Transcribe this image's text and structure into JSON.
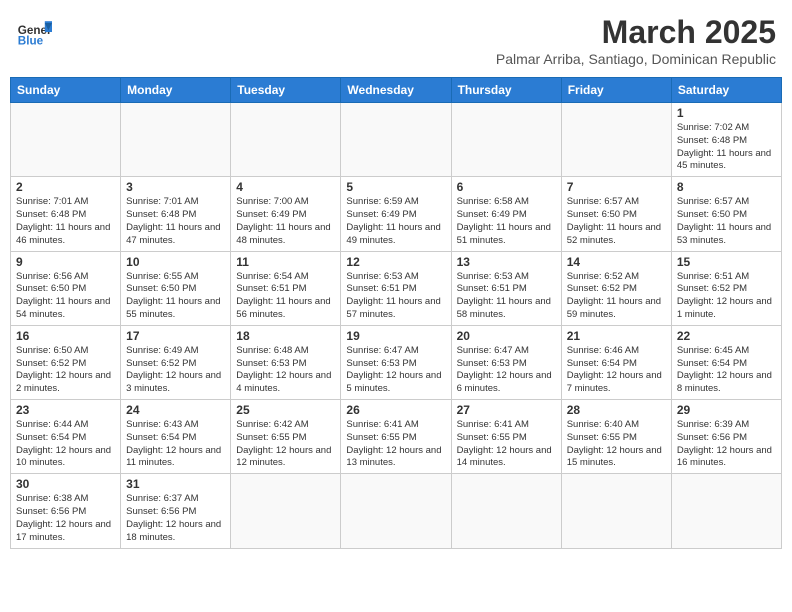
{
  "header": {
    "logo_general": "General",
    "logo_blue": "Blue",
    "month_year": "March 2025",
    "location": "Palmar Arriba, Santiago, Dominican Republic"
  },
  "weekdays": [
    "Sunday",
    "Monday",
    "Tuesday",
    "Wednesday",
    "Thursday",
    "Friday",
    "Saturday"
  ],
  "days": {
    "d1": {
      "num": "1",
      "sr": "7:02 AM",
      "ss": "6:48 PM",
      "dl": "11 hours and 45 minutes."
    },
    "d2": {
      "num": "2",
      "sr": "7:01 AM",
      "ss": "6:48 PM",
      "dl": "11 hours and 46 minutes."
    },
    "d3": {
      "num": "3",
      "sr": "7:01 AM",
      "ss": "6:48 PM",
      "dl": "11 hours and 47 minutes."
    },
    "d4": {
      "num": "4",
      "sr": "7:00 AM",
      "ss": "6:49 PM",
      "dl": "11 hours and 48 minutes."
    },
    "d5": {
      "num": "5",
      "sr": "6:59 AM",
      "ss": "6:49 PM",
      "dl": "11 hours and 49 minutes."
    },
    "d6": {
      "num": "6",
      "sr": "6:58 AM",
      "ss": "6:49 PM",
      "dl": "11 hours and 51 minutes."
    },
    "d7": {
      "num": "7",
      "sr": "6:57 AM",
      "ss": "6:50 PM",
      "dl": "11 hours and 52 minutes."
    },
    "d8": {
      "num": "8",
      "sr": "6:57 AM",
      "ss": "6:50 PM",
      "dl": "11 hours and 53 minutes."
    },
    "d9": {
      "num": "9",
      "sr": "6:56 AM",
      "ss": "6:50 PM",
      "dl": "11 hours and 54 minutes."
    },
    "d10": {
      "num": "10",
      "sr": "6:55 AM",
      "ss": "6:50 PM",
      "dl": "11 hours and 55 minutes."
    },
    "d11": {
      "num": "11",
      "sr": "6:54 AM",
      "ss": "6:51 PM",
      "dl": "11 hours and 56 minutes."
    },
    "d12": {
      "num": "12",
      "sr": "6:53 AM",
      "ss": "6:51 PM",
      "dl": "11 hours and 57 minutes."
    },
    "d13": {
      "num": "13",
      "sr": "6:53 AM",
      "ss": "6:51 PM",
      "dl": "11 hours and 58 minutes."
    },
    "d14": {
      "num": "14",
      "sr": "6:52 AM",
      "ss": "6:52 PM",
      "dl": "11 hours and 59 minutes."
    },
    "d15": {
      "num": "15",
      "sr": "6:51 AM",
      "ss": "6:52 PM",
      "dl": "12 hours and 1 minute."
    },
    "d16": {
      "num": "16",
      "sr": "6:50 AM",
      "ss": "6:52 PM",
      "dl": "12 hours and 2 minutes."
    },
    "d17": {
      "num": "17",
      "sr": "6:49 AM",
      "ss": "6:52 PM",
      "dl": "12 hours and 3 minutes."
    },
    "d18": {
      "num": "18",
      "sr": "6:48 AM",
      "ss": "6:53 PM",
      "dl": "12 hours and 4 minutes."
    },
    "d19": {
      "num": "19",
      "sr": "6:47 AM",
      "ss": "6:53 PM",
      "dl": "12 hours and 5 minutes."
    },
    "d20": {
      "num": "20",
      "sr": "6:47 AM",
      "ss": "6:53 PM",
      "dl": "12 hours and 6 minutes."
    },
    "d21": {
      "num": "21",
      "sr": "6:46 AM",
      "ss": "6:54 PM",
      "dl": "12 hours and 7 minutes."
    },
    "d22": {
      "num": "22",
      "sr": "6:45 AM",
      "ss": "6:54 PM",
      "dl": "12 hours and 8 minutes."
    },
    "d23": {
      "num": "23",
      "sr": "6:44 AM",
      "ss": "6:54 PM",
      "dl": "12 hours and 10 minutes."
    },
    "d24": {
      "num": "24",
      "sr": "6:43 AM",
      "ss": "6:54 PM",
      "dl": "12 hours and 11 minutes."
    },
    "d25": {
      "num": "25",
      "sr": "6:42 AM",
      "ss": "6:55 PM",
      "dl": "12 hours and 12 minutes."
    },
    "d26": {
      "num": "26",
      "sr": "6:41 AM",
      "ss": "6:55 PM",
      "dl": "12 hours and 13 minutes."
    },
    "d27": {
      "num": "27",
      "sr": "6:41 AM",
      "ss": "6:55 PM",
      "dl": "12 hours and 14 minutes."
    },
    "d28": {
      "num": "28",
      "sr": "6:40 AM",
      "ss": "6:55 PM",
      "dl": "12 hours and 15 minutes."
    },
    "d29": {
      "num": "29",
      "sr": "6:39 AM",
      "ss": "6:56 PM",
      "dl": "12 hours and 16 minutes."
    },
    "d30": {
      "num": "30",
      "sr": "6:38 AM",
      "ss": "6:56 PM",
      "dl": "12 hours and 17 minutes."
    },
    "d31": {
      "num": "31",
      "sr": "6:37 AM",
      "ss": "6:56 PM",
      "dl": "12 hours and 18 minutes."
    }
  }
}
